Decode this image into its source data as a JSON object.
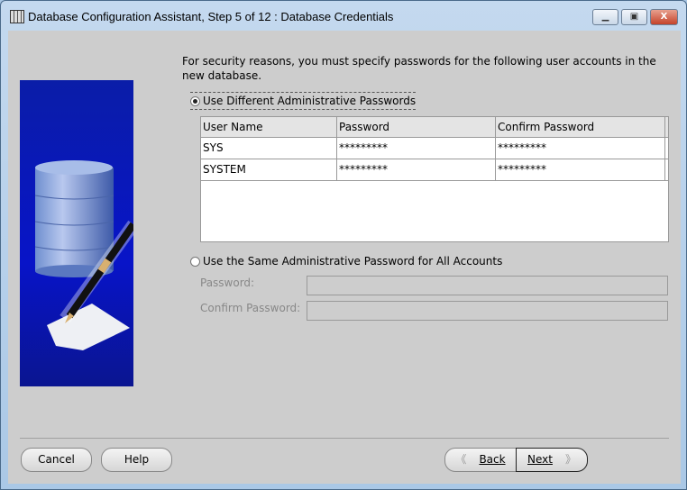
{
  "window": {
    "title": "Database Configuration Assistant, Step 5 of 12 : Database Credentials",
    "minimize": "▁",
    "maximize": "▣",
    "close": "X"
  },
  "intro": "For security reasons, you must specify passwords for the following user accounts in the new database.",
  "option_different": "Use Different Administrative Passwords",
  "option_same": "Use the Same Administrative Password for All Accounts",
  "table": {
    "headers": [
      "User Name",
      "Password",
      "Confirm Password"
    ],
    "rows": [
      [
        "SYS",
        "*********",
        "*********"
      ],
      [
        "SYSTEM",
        "*********",
        "*********"
      ]
    ]
  },
  "same": {
    "password_label": "Password:",
    "confirm_label": "Confirm Password:"
  },
  "buttons": {
    "cancel": "Cancel",
    "help": "Help",
    "back": "Back",
    "next": "Next"
  }
}
